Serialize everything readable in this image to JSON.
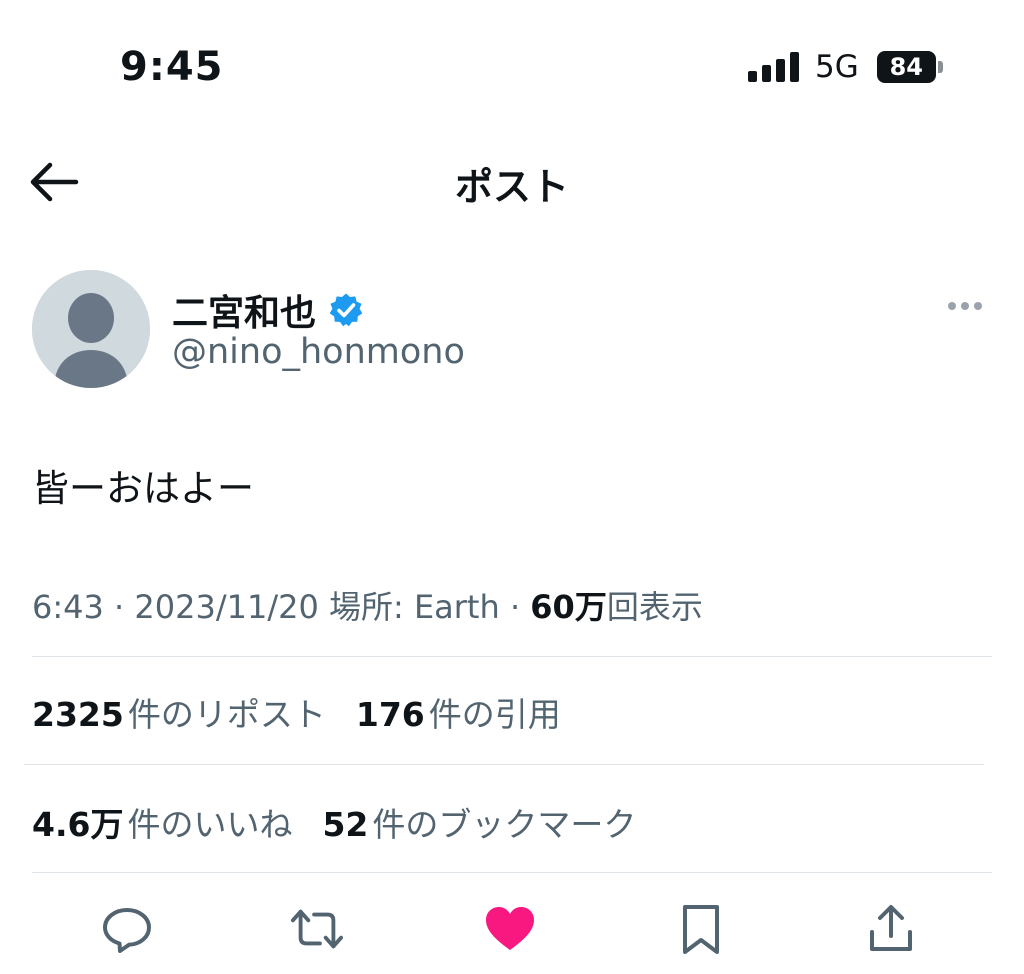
{
  "status_bar": {
    "time": "9:45",
    "network": "5G",
    "battery": "84"
  },
  "header": {
    "title": "ポスト",
    "back_icon": "arrow-left-icon"
  },
  "author": {
    "display_name": "二宮和也",
    "verified_badge_color": "#1d9bf0",
    "handle": "@nino_honmono",
    "avatar_bg": "#cfd9de",
    "avatar_fg": "#697787"
  },
  "post": {
    "text": "皆ーおはよー"
  },
  "meta": {
    "time": "6:43",
    "date": "2023/11/20",
    "location_label": "場所: Earth",
    "separator": "·",
    "views_count": "60万",
    "views_label": "回表示"
  },
  "stats": {
    "reposts_count": "2325",
    "reposts_label": "件のリポスト",
    "quotes_count": "176",
    "quotes_label": "件の引用",
    "likes_count": "4.6万",
    "likes_label": "件のいいね",
    "bookmarks_count": "52",
    "bookmarks_label": "件のブックマーク"
  },
  "actions": {
    "reply_icon": "reply-icon",
    "repost_icon": "repost-icon",
    "like_icon": "heart-icon",
    "like_color": "#f91880",
    "bookmark_icon": "bookmark-icon",
    "share_icon": "share-icon",
    "icon_color": "#536471"
  }
}
